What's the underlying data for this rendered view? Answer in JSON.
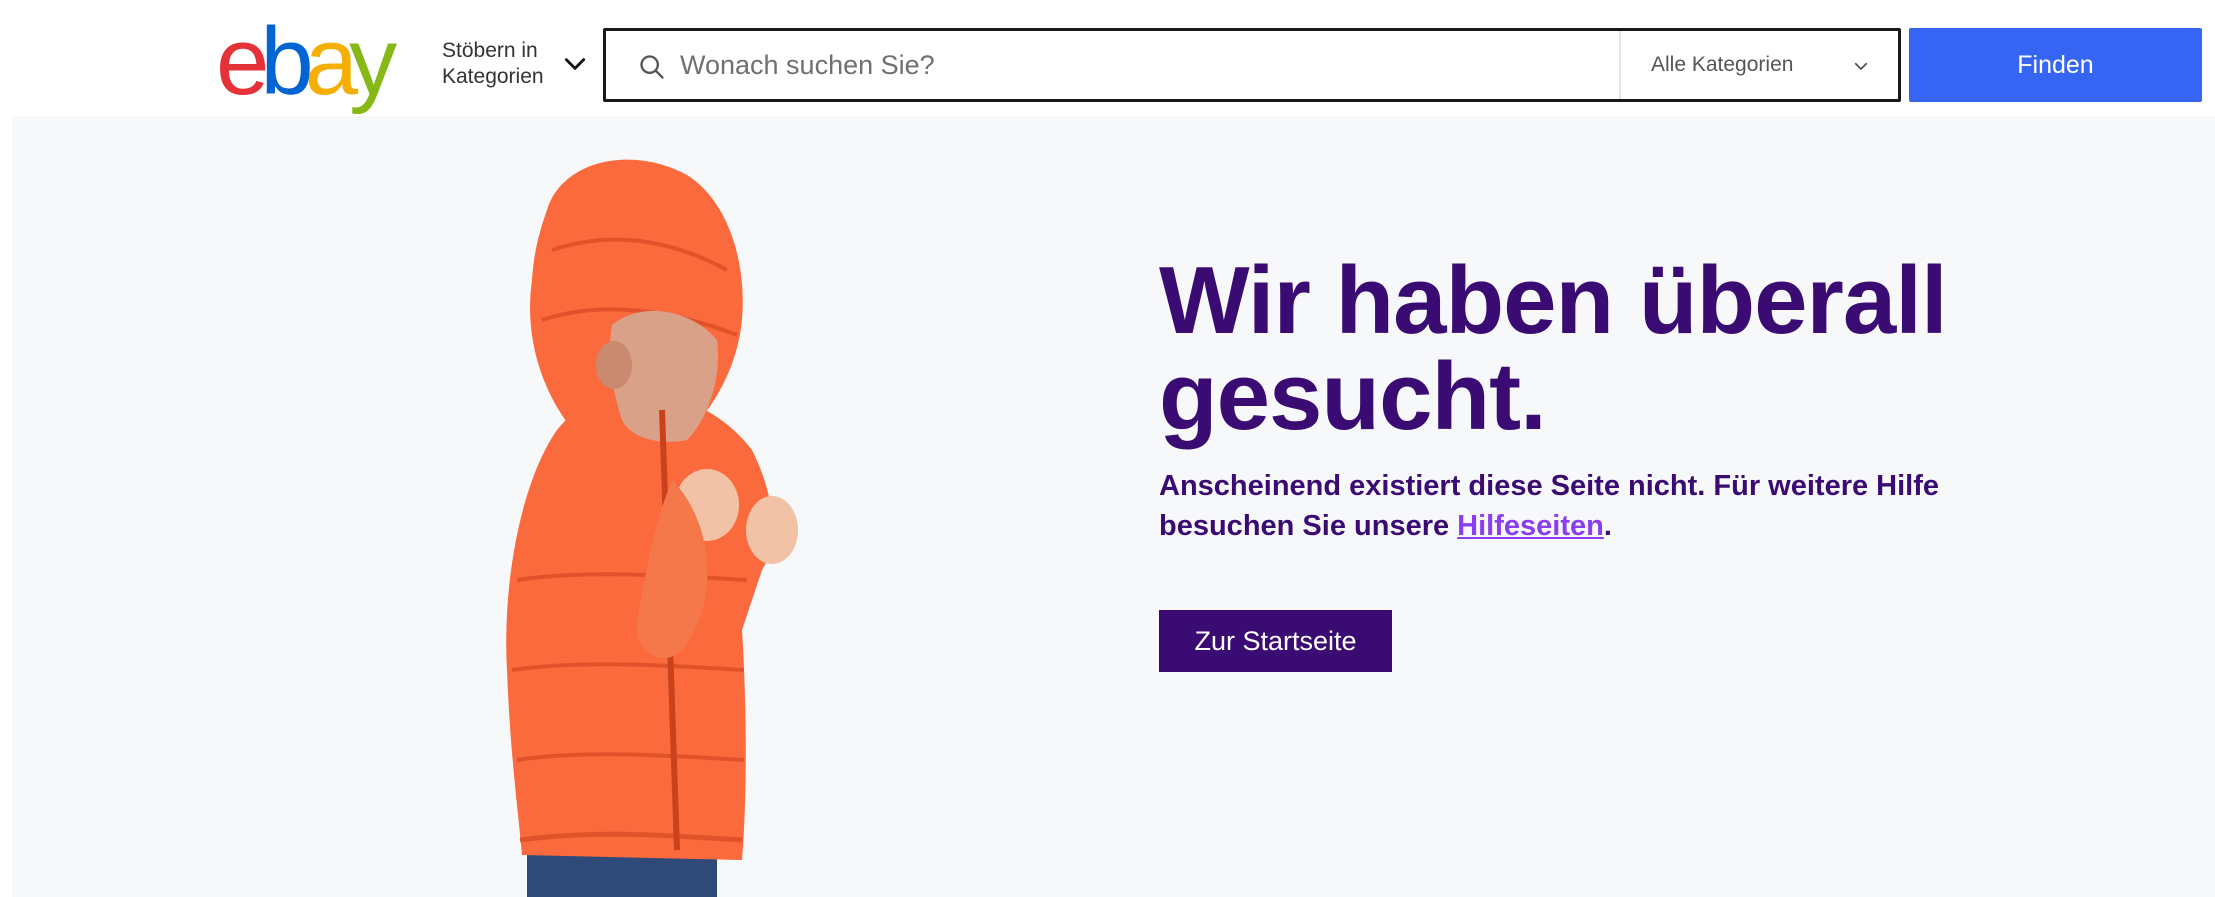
{
  "header": {
    "logo": {
      "e": "e",
      "b": "b",
      "a": "a",
      "y": "y"
    },
    "browse_label": "Stöbern in Kategorien",
    "search": {
      "placeholder": "Wonach suchen Sie?",
      "value": ""
    },
    "category": "Alle Kategorien",
    "find_label": "Finden"
  },
  "hero": {
    "headline": "Wir haben überall gesucht.",
    "subtext_before": "Anscheinend existiert diese Seite nicht. Für weitere Hilfe besuchen Sie unsere ",
    "help_link": "Hilfeseiten",
    "subtext_after": ".",
    "home_button": "Zur Startseite"
  },
  "colors": {
    "brand_red": "#e53238",
    "brand_blue": "#0064d2",
    "brand_yellow": "#f5af02",
    "brand_green": "#86b817",
    "find_button": "#3665f3",
    "headline_purple": "#3b0b74",
    "link_purple": "#8a3ef0",
    "hero_background": "#f7f8fa"
  },
  "icons": {
    "search": "search-icon",
    "browse_chevron": "chevron-down-icon",
    "category_chevron": "chevron-down-icon"
  }
}
